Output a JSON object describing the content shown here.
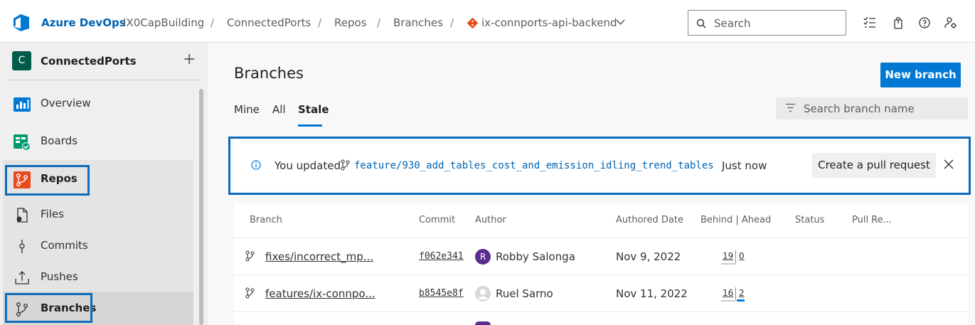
{
  "header": {
    "brand": "Azure DevOps",
    "breadcrumbs": [
      "IX0CapBuilding",
      "ConnectedPorts",
      "Repos",
      "Branches"
    ],
    "separator": "/",
    "repo_name": "ix-connports-api-backend",
    "search_placeholder": "Search",
    "icons": [
      "task-list-icon",
      "shopping-bag-icon",
      "help-icon",
      "user-settings-icon"
    ]
  },
  "sidebar": {
    "project_initial": "C",
    "project_name": "ConnectedPorts",
    "add_label": "+",
    "items": [
      {
        "label": "Overview",
        "icon": "overview-icon"
      },
      {
        "label": "Boards",
        "icon": "boards-icon"
      },
      {
        "label": "Repos",
        "icon": "repos-icon"
      },
      {
        "label": "Files",
        "icon": "files-icon"
      },
      {
        "label": "Commits",
        "icon": "commits-icon"
      },
      {
        "label": "Pushes",
        "icon": "pushes-icon"
      },
      {
        "label": "Branches",
        "icon": "branch-icon"
      }
    ]
  },
  "main": {
    "title": "Branches",
    "new_branch_label": "New branch",
    "tabs": [
      "Mine",
      "All",
      "Stale"
    ],
    "active_tab": "Stale",
    "filter_placeholder": "Search branch name",
    "banner": {
      "prefix": "You updated",
      "branch": "feature/930_add_tables_cost_and_emission_idling_trend_tables",
      "suffix": "Just now",
      "button": "Create a pull request"
    },
    "table": {
      "headers": [
        "Branch",
        "Commit",
        "Author",
        "Authored Date",
        "Behind | Ahead",
        "Status",
        "Pull Re..."
      ],
      "rows": [
        {
          "branch": "fixes/incorrect_mp...",
          "commit": "f062e341",
          "author_initial": "R",
          "author": "Robby Salonga",
          "date": "Nov 9, 2022",
          "behind": "19",
          "ahead": "0"
        },
        {
          "branch": "features/ix-connpo...",
          "commit": "b8545e8f",
          "author_initial": "",
          "author": "Ruel Sarno",
          "date": "Nov 11, 2022",
          "behind": "16",
          "ahead": "2"
        }
      ]
    }
  },
  "colors": {
    "accent": "#0078d4",
    "highlight": "#0f6cbd",
    "brand_text": "#0063b1",
    "project_avatar": "#025a4a",
    "author_avatar": "#5c2d91"
  }
}
